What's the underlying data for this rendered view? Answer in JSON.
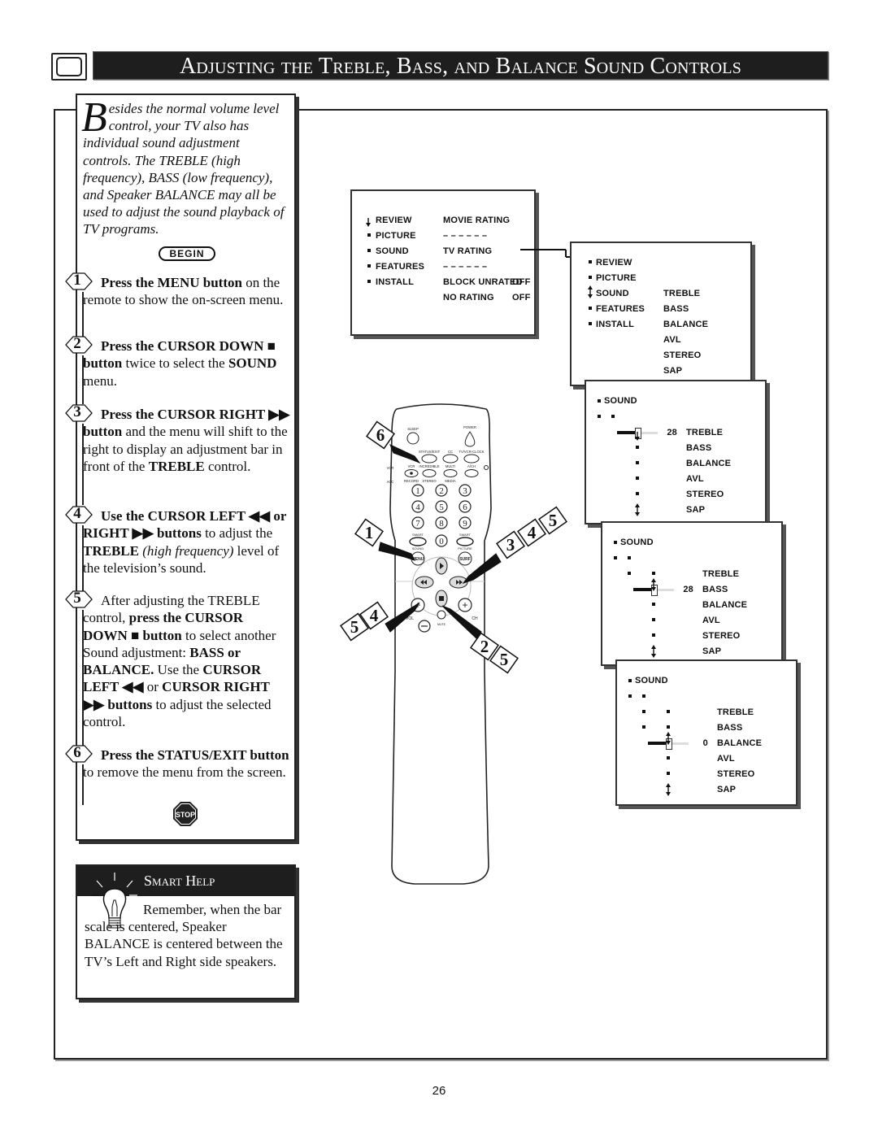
{
  "header": {
    "icon": "tv-icon",
    "title": "Adjusting the Treble, Bass, and Balance Sound Controls"
  },
  "intro": {
    "dropcap": "B",
    "text": "esides the normal volume level control, your TV also has individual sound adjustment controls. The TREBLE (high frequency), BASS (low frequency), and Speaker BALANCE may all be used to adjust the sound playback of TV programs."
  },
  "begin_label": "BEGIN",
  "steps": [
    {
      "num": "1",
      "parts": [
        {
          "b": "Press the MENU button"
        },
        {
          "t": " on the remote to show the on-screen menu."
        }
      ]
    },
    {
      "num": "2",
      "parts": [
        {
          "b": "Press the CURSOR DOWN ■ button"
        },
        {
          "t": " twice to select the "
        },
        {
          "b": "SOUND"
        },
        {
          "t": " menu."
        }
      ]
    },
    {
      "num": "3",
      "parts": [
        {
          "b": "Press the CURSOR RIGHT ▶▶ button"
        },
        {
          "t": " and the menu will shift to the right to display an adjustment bar in front of the "
        },
        {
          "b": "TREBLE"
        },
        {
          "t": " control."
        }
      ]
    },
    {
      "num": "4",
      "parts": [
        {
          "b": "Use the CURSOR LEFT ◀◀ or RIGHT ▶▶ buttons"
        },
        {
          "t": " to adjust the "
        },
        {
          "b": "TREBLE"
        },
        {
          "i": " (high frequency)"
        },
        {
          "t": " level of the television’s sound."
        }
      ]
    },
    {
      "num": "5",
      "parts": [
        {
          "t": "After adjusting the TREBLE control, "
        },
        {
          "b": "press the CURSOR DOWN ■ button"
        },
        {
          "t": " to select another Sound adjustment: "
        },
        {
          "b": "BASS or BALANCE."
        },
        {
          "t": " Use the "
        },
        {
          "b": "CURSOR LEFT ◀◀"
        },
        {
          "t": " or "
        },
        {
          "b": "CURSOR RIGHT ▶▶ buttons"
        },
        {
          "t": " to adjust the selected control."
        }
      ]
    },
    {
      "num": "6",
      "parts": [
        {
          "b": "Press the STATUS/EXIT button"
        },
        {
          "t": " to remove the menu from the screen."
        }
      ]
    }
  ],
  "stop_label": "STOP",
  "smart_help": {
    "title": "Smart Help",
    "text": "Remember, when the bar scale is centered, Speaker BALANCE is centered between the TV’s Left and Right side speakers."
  },
  "remote": {
    "buttons_top": [
      "SLEEP",
      "POWER",
      "STATUS/EXIT",
      "CC",
      "TV/VCR-CLOCK"
    ],
    "mode_labels": [
      "VCR",
      "ACC"
    ],
    "buttons_row2": [
      "VCR",
      "INCREDIBLE",
      "MULTI",
      "A/CH"
    ],
    "labels_row3": [
      "RECORD",
      "STEREO",
      "MEDIA"
    ],
    "digits": [
      "1",
      "2",
      "3",
      "4",
      "5",
      "6",
      "7",
      "8",
      "9",
      "0"
    ],
    "smart_labels": [
      "SMART",
      "SMART"
    ],
    "sub_labels": [
      "SOUND",
      "PICTURE"
    ],
    "menu_label": "MENU",
    "surf_label": "SURF",
    "vol_label": "VOL",
    "ch_label": "CH",
    "mute_label": "MUTE",
    "callouts": [
      {
        "label": "6"
      },
      {
        "label": "1"
      },
      {
        "label": "3"
      },
      {
        "label": "4"
      },
      {
        "label": "5"
      },
      {
        "label": "4"
      },
      {
        "label": "5"
      },
      {
        "label": "2"
      },
      {
        "label": "5"
      }
    ]
  },
  "menus": {
    "main": {
      "left": [
        "REVIEW",
        "PICTURE",
        "SOUND",
        "FEATURES",
        "INSTALL"
      ],
      "right": [
        {
          "label": "MOVIE RATING",
          "value": ""
        },
        {
          "label": "– – – – – –",
          "value": ""
        },
        {
          "label": "TV RATING",
          "value": ""
        },
        {
          "label": "– – – – – –",
          "value": ""
        },
        {
          "label": "BLOCK UNRATED",
          "value": "OFF"
        },
        {
          "label": "NO RATING",
          "value": "OFF"
        }
      ]
    },
    "sound_select": {
      "left": [
        "REVIEW",
        "PICTURE",
        "SOUND",
        "FEATURES",
        "INSTALL"
      ],
      "right": [
        "TREBLE",
        "BASS",
        "BALANCE",
        "AVL",
        "STEREO",
        "SAP"
      ]
    },
    "treble_adjust": {
      "title": "SOUND",
      "items": [
        "TREBLE",
        "BASS",
        "BALANCE",
        "AVL",
        "STEREO",
        "SAP"
      ],
      "active": "TREBLE",
      "value": "28",
      "level": 0.5
    },
    "bass_adjust": {
      "title": "SOUND",
      "items": [
        "TREBLE",
        "BASS",
        "BALANCE",
        "AVL",
        "STEREO",
        "SAP"
      ],
      "active": "BASS",
      "value": "28",
      "level": 0.5
    },
    "balance_adjust": {
      "title": "SOUND",
      "items": [
        "TREBLE",
        "BASS",
        "BALANCE",
        "AVL",
        "STEREO",
        "SAP"
      ],
      "active": "BALANCE",
      "value": "0",
      "level": 0.5
    }
  },
  "page_number": "26"
}
